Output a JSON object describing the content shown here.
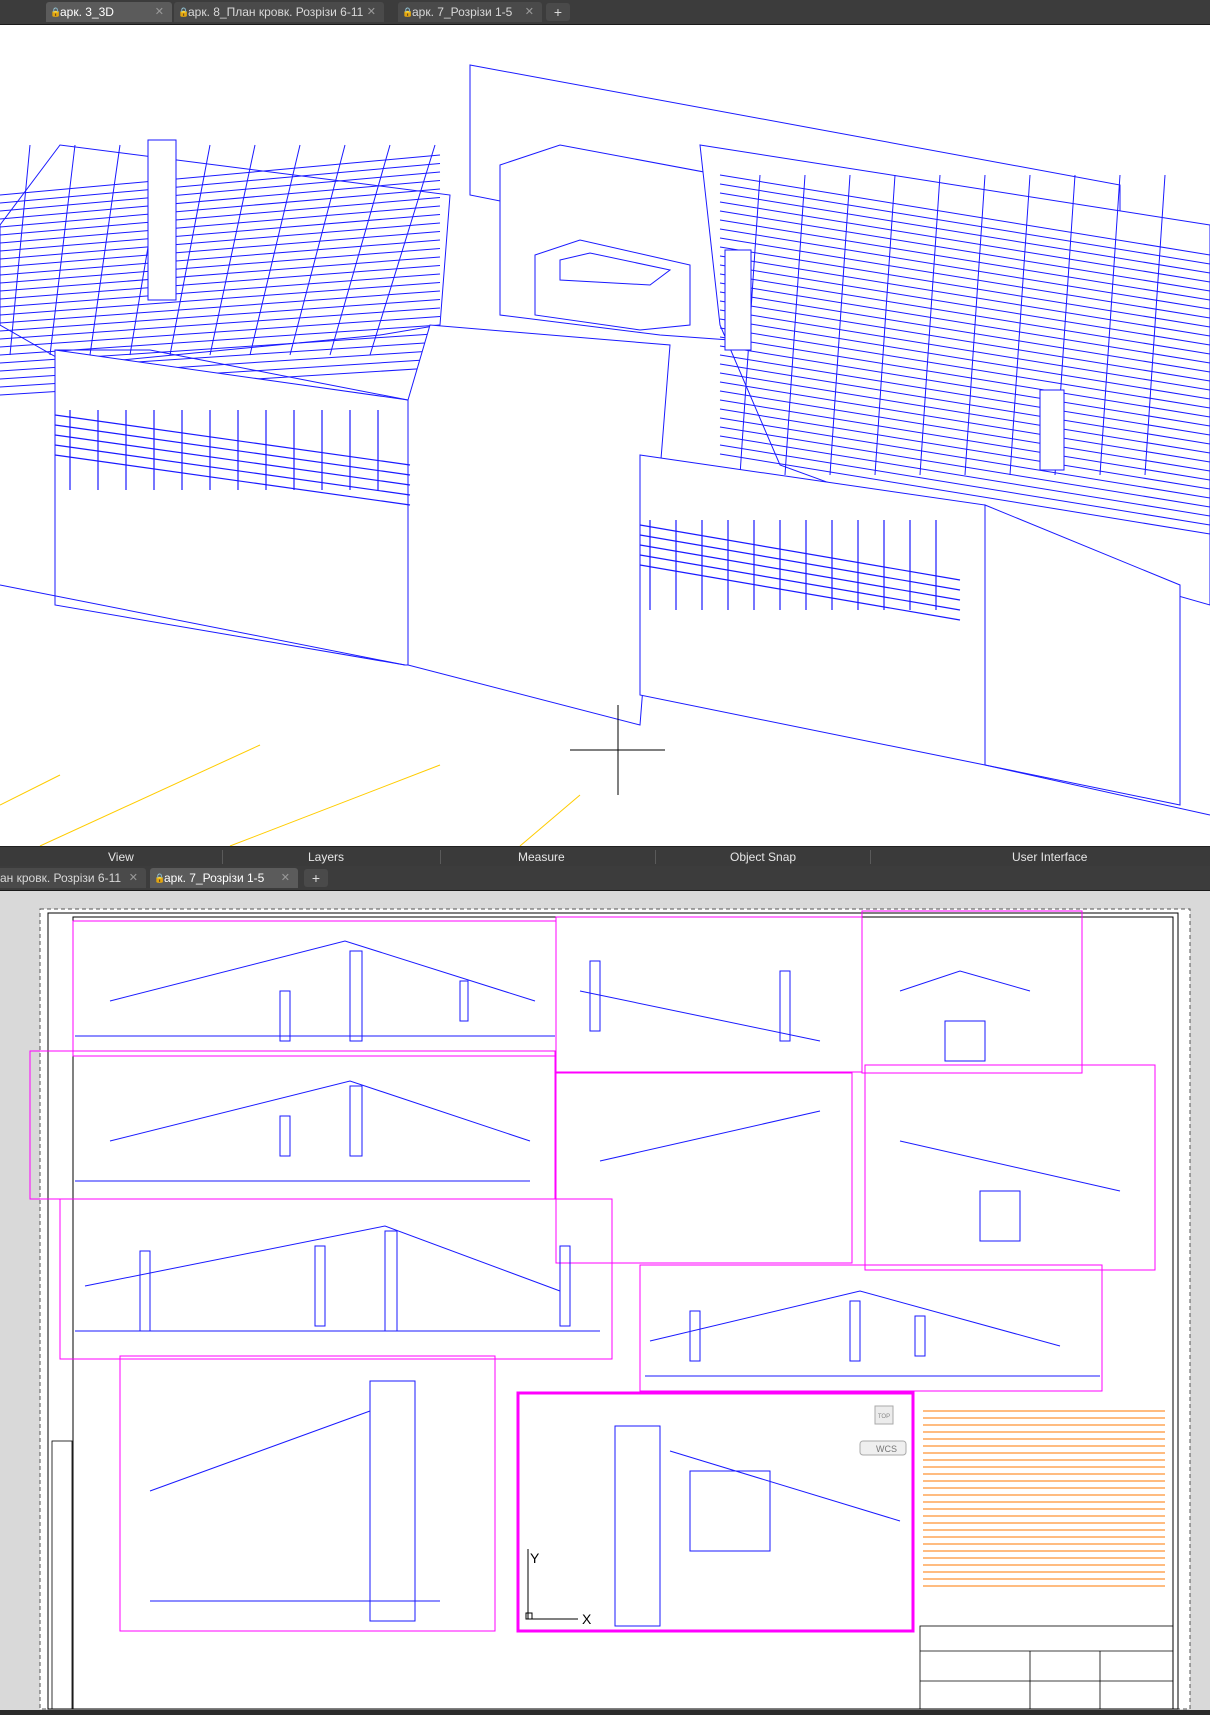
{
  "top_window": {
    "tabs": [
      {
        "label": "арк. 3_3D",
        "active": true
      },
      {
        "label": "арк. 8_План кровк. Розрізи 6-11",
        "active": false
      },
      {
        "label": "арк. 7_Розрізи 1-5",
        "active": false
      }
    ],
    "new_tab_label": "+"
  },
  "ribbon": {
    "panels": [
      "View",
      "Layers",
      "Measure",
      "Object Snap",
      "User Interface"
    ]
  },
  "bottom_window": {
    "tabs": [
      {
        "label": "ан кровк. Розрізи 6-11",
        "active": false
      },
      {
        "label": "арк. 7_Розрізи 1-5",
        "active": true
      }
    ],
    "new_tab_label": "+"
  },
  "viewcube": {
    "top_label": "TOP",
    "wcs_label": "WCS"
  },
  "ucs": {
    "x_label": "X",
    "y_label": "Y"
  },
  "colors": {
    "model_lines": "#1a1aff",
    "annotation": "#ff7a00",
    "viewport_frame": "#ff00ff",
    "grid_axis": "#ffcc00"
  }
}
